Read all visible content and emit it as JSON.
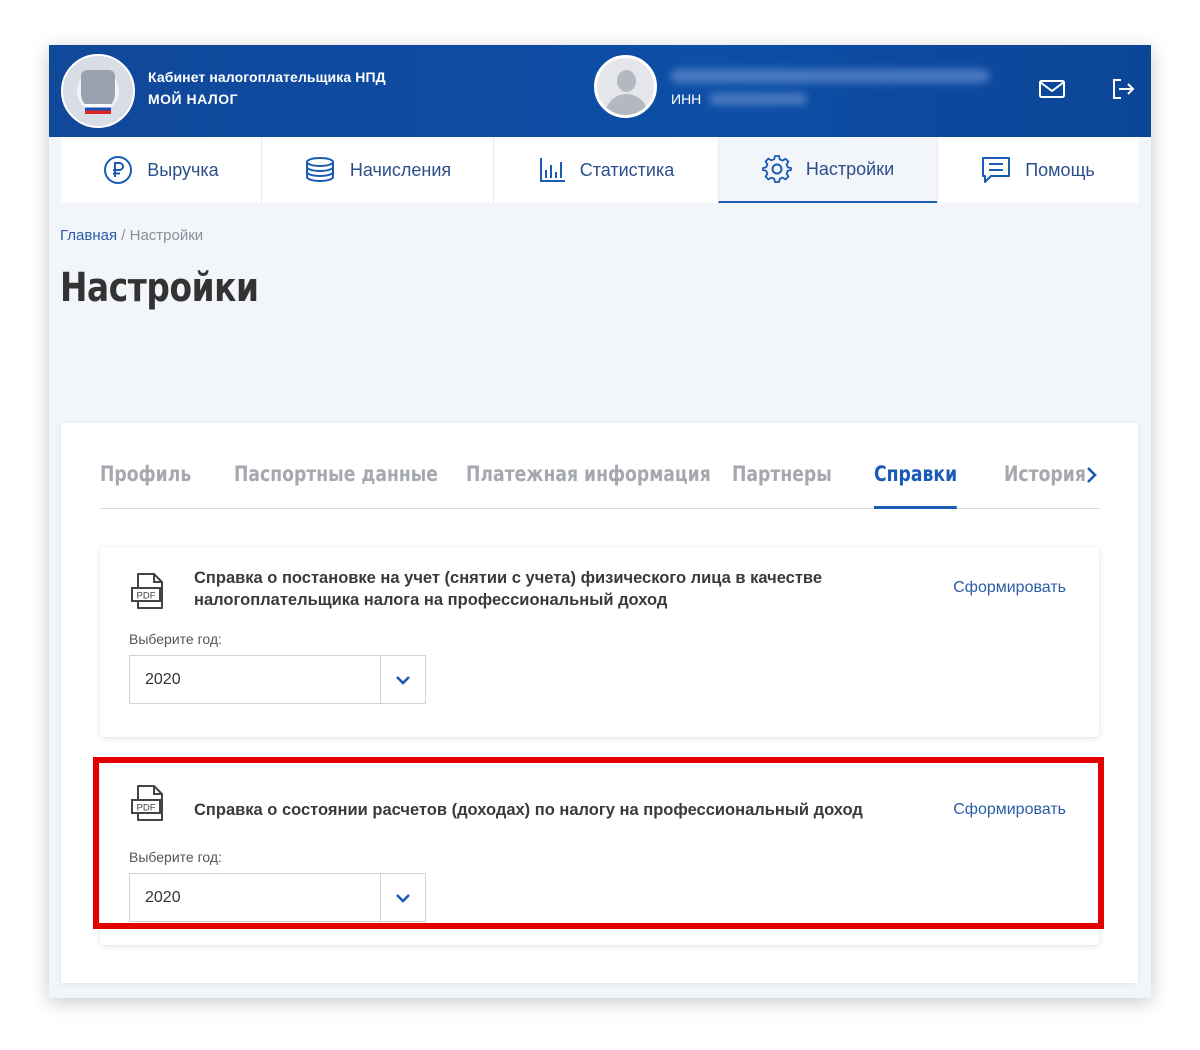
{
  "header": {
    "title_line1": "Кабинет налогоплательщика НПД",
    "title_line2": "МОЙ НАЛОГ",
    "inn_label": "ИНН"
  },
  "nav": {
    "items": [
      {
        "label": "Выручка",
        "icon": "ruble-icon"
      },
      {
        "label": "Начисления",
        "icon": "coins-stack-icon"
      },
      {
        "label": "Статистика",
        "icon": "bar-chart-icon"
      },
      {
        "label": "Настройки",
        "icon": "gear-icon",
        "active": true
      },
      {
        "label": "Помощь",
        "icon": "help-chat-icon"
      }
    ]
  },
  "breadcrumb": {
    "home": "Главная",
    "separator": "/",
    "current": "Настройки"
  },
  "page_title": "Настройки",
  "tabs": {
    "items": [
      "Профиль",
      "Паспортные данные",
      "Платежная информация",
      "Партнеры",
      "Справки",
      "История"
    ],
    "active": "Справки"
  },
  "documents": [
    {
      "icon_label": "PDF",
      "title": "Справка о постановке на учет (снятии с учета) физического лица в качестве налогоплательщика налога на профессиональный доход",
      "action": "Сформировать",
      "year_label": "Выберите год:",
      "year_value": "2020"
    },
    {
      "icon_label": "PDF",
      "title": "Справка о состоянии расчетов (доходах) по налогу на профессиональный доход",
      "action": "Сформировать",
      "year_label": "Выберите год:",
      "year_value": "2020"
    }
  ],
  "colors": {
    "header_blue": "#0d4ea6",
    "link_blue": "#2b5ca6",
    "active_blue": "#1a5bb5",
    "highlight_red": "#e40000"
  }
}
